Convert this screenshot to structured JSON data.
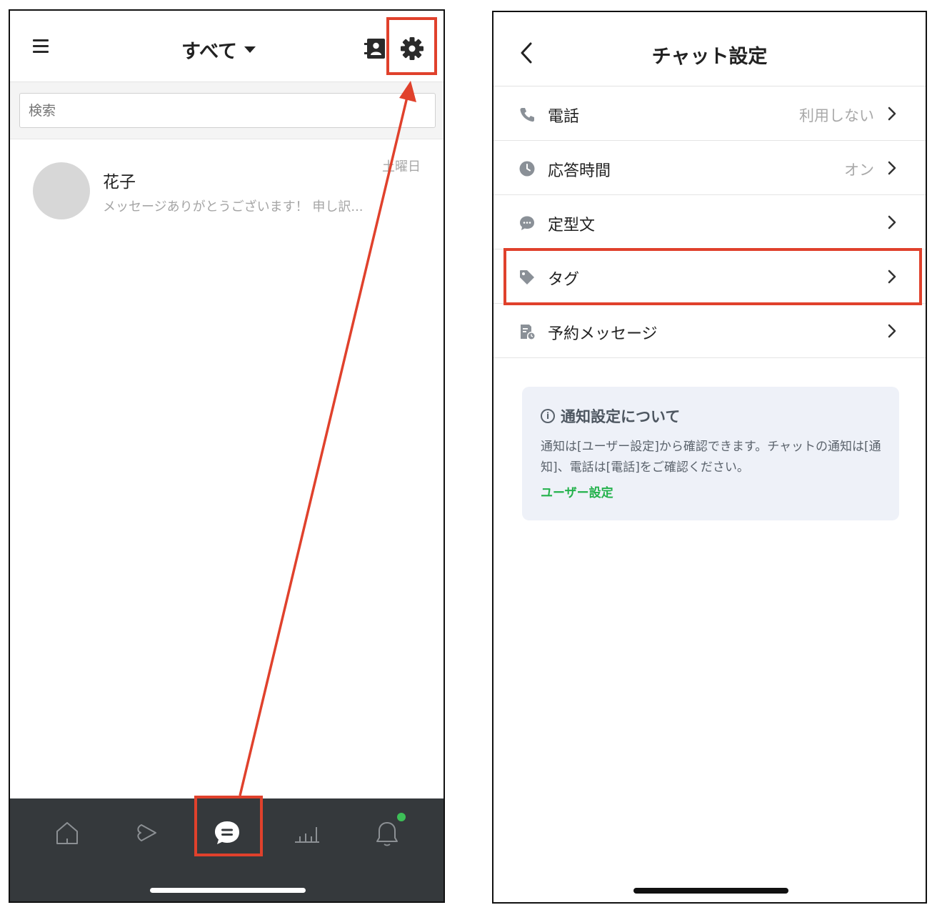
{
  "left_screen": {
    "header": {
      "filter_label": "すべて"
    },
    "search": {
      "placeholder": "検索"
    },
    "chats": [
      {
        "name": "花子",
        "preview": "メッセージありがとうございます！ 申し訳...",
        "date": "土曜日"
      }
    ],
    "tabbar": {
      "tabs": [
        "home-icon",
        "voom-icon",
        "chat-icon",
        "analytics-icon",
        "bell-icon"
      ],
      "active": "chat-icon",
      "notification_dot_color": "#3dbf57"
    }
  },
  "right_screen": {
    "header": {
      "title": "チャット設定"
    },
    "settings": [
      {
        "icon": "phone-icon",
        "label": "電話",
        "value": "利用しない"
      },
      {
        "icon": "clock-icon",
        "label": "応答時間",
        "value": "オン"
      },
      {
        "icon": "speech-bubble-icon",
        "label": "定型文",
        "value": ""
      },
      {
        "icon": "tag-icon",
        "label": "タグ",
        "value": ""
      },
      {
        "icon": "scheduled-message-icon",
        "label": "予約メッセージ",
        "value": ""
      }
    ],
    "info": {
      "title": "通知設定について",
      "body": "通知は[ユーザー設定]から確認できます。チャットの通知は[通知]、電話は[電話]をご確認ください。",
      "link": "ユーザー設定"
    }
  },
  "colors": {
    "highlight": "#e0412c",
    "tabbar_bg": "#35393c",
    "link_green": "#24b24c",
    "info_bg": "#eef1f8"
  }
}
